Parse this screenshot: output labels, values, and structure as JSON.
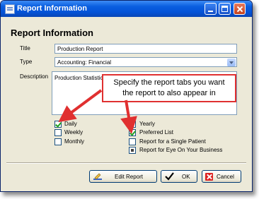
{
  "window": {
    "title": "Report Information"
  },
  "heading": "Report Information",
  "fields": {
    "title_label": "Title",
    "title_value": "Production Report",
    "type_label": "Type",
    "type_value": "Accounting: Financial",
    "description_label": "Description",
    "description_value": "Production Statistics"
  },
  "callout": {
    "line1": "Specify the report tabs you want",
    "line2": "the report to also appear in"
  },
  "checkboxes": {
    "daily": {
      "label": "Daily",
      "state": "checked"
    },
    "weekly": {
      "label": "Weekly",
      "state": "unchecked"
    },
    "monthly": {
      "label": "Monthly",
      "state": "unchecked"
    },
    "yearly": {
      "label": "Yearly",
      "state": "unchecked"
    },
    "preferred_list": {
      "label": "Preferred List",
      "state": "checked"
    },
    "single_patient": {
      "label": "Report for a Single Patient",
      "state": "unchecked"
    },
    "eye_on_business": {
      "label": "Report for Eye On Your Business",
      "state": "partial"
    }
  },
  "buttons": {
    "edit_report": "Edit Report",
    "ok": "OK",
    "cancel": "Cancel"
  },
  "colors": {
    "callout_border": "#e03030",
    "arrow": "#e03030",
    "title_bar": "#0453d8"
  },
  "icons": [
    "app-icon",
    "minimize-icon",
    "maximize-icon",
    "close-icon",
    "dropdown-arrow-icon",
    "edit-report-icon",
    "checkmark-icon",
    "cancel-x-icon"
  ]
}
